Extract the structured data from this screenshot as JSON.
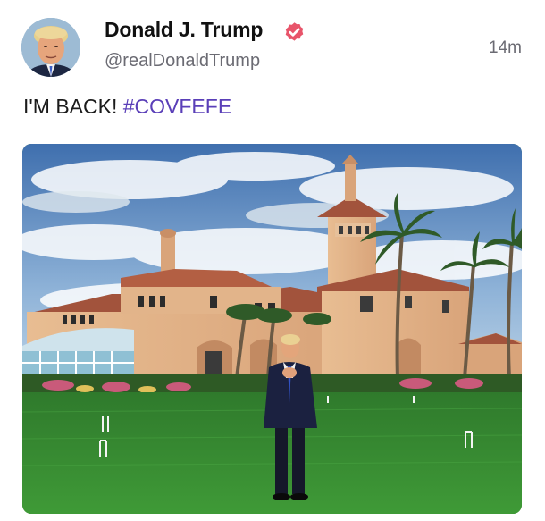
{
  "author": {
    "display_name": "Donald J. Trump",
    "handle": "@realDonaldTrump",
    "verified_icon": "verified-badge-icon",
    "avatar_icon": "user-avatar"
  },
  "post": {
    "timestamp": "14m",
    "text_plain": "I'M BACK!",
    "hashtag": "#COVFEFE",
    "media_alt_subject": "photo"
  },
  "colors": {
    "hashtag": "#5a3fb8",
    "verified_badge": "#e8546a",
    "text": "#111111",
    "muted": "#6b6b73"
  }
}
